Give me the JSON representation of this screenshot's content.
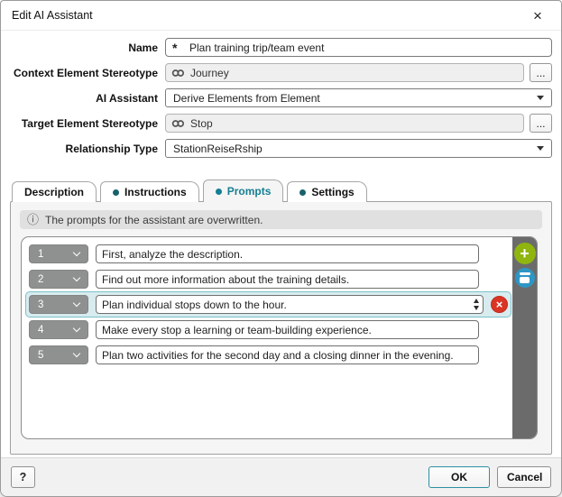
{
  "dialog": {
    "title": "Edit AI Assistant"
  },
  "icons": {
    "close": "×",
    "required": "*",
    "info": "ⓘ",
    "add": "+",
    "delete_x": "×",
    "link": "two-interlocked-rings (css/svg shape)",
    "combo_arrow": "filled-triangle-down (css shape)",
    "number_chevron": "white-chevron-down (css shape)",
    "spinner": "up/down triangles (css shape)",
    "trash": "lid-and-bin white shape on blue circle (css shape)"
  },
  "form": {
    "fields": [
      {
        "label": "Name",
        "type": "text",
        "value": "Plan training trip/team event"
      },
      {
        "label": "Context Element Stereotype",
        "type": "readonly",
        "value": "Journey",
        "browse_label": "..."
      },
      {
        "label": "AI Assistant",
        "type": "dropdown",
        "value": "Derive Elements from Element"
      },
      {
        "label": "Target Element Stereotype",
        "type": "readonly",
        "value": "Stop",
        "browse_label": "..."
      },
      {
        "label": "Relationship Type",
        "type": "dropdown",
        "value": "StationReiseRship"
      }
    ]
  },
  "tabs": [
    {
      "label": "Description",
      "bullet": false,
      "active": false
    },
    {
      "label": "Instructions",
      "bullet": true,
      "active": false
    },
    {
      "label": "Prompts",
      "bullet": true,
      "active": true
    },
    {
      "label": "Settings",
      "bullet": true,
      "active": false
    }
  ],
  "prompts_tab": {
    "info_message": "The prompts for the assistant are overwritten.",
    "rows": [
      {
        "number": "1",
        "text": "First, analyze the description.",
        "selected": false
      },
      {
        "number": "2",
        "text": "Find out more information about the training details.",
        "selected": false
      },
      {
        "number": "3",
        "text": "Plan individual stops down to the hour.",
        "selected": true
      },
      {
        "number": "4",
        "text": "Make every stop a learning or team-building experience.",
        "selected": false
      },
      {
        "number": "5",
        "text": "Plan two activities for the second day and a closing dinner in the evening.",
        "selected": false
      }
    ]
  },
  "footer": {
    "help_label": "?",
    "ok_label": "OK",
    "cancel_label": "Cancel"
  },
  "colors": {
    "accent_teal": "#157f93",
    "inactive_bullet": "#17616b",
    "selected_row_bg": "#d8ecef",
    "selected_row_border": "#7cc0cb",
    "add_green": "#8fb50e",
    "action_blue": "#2e96c4",
    "delete_red": "#da3425",
    "strip_gray": "#6b6b6b"
  }
}
